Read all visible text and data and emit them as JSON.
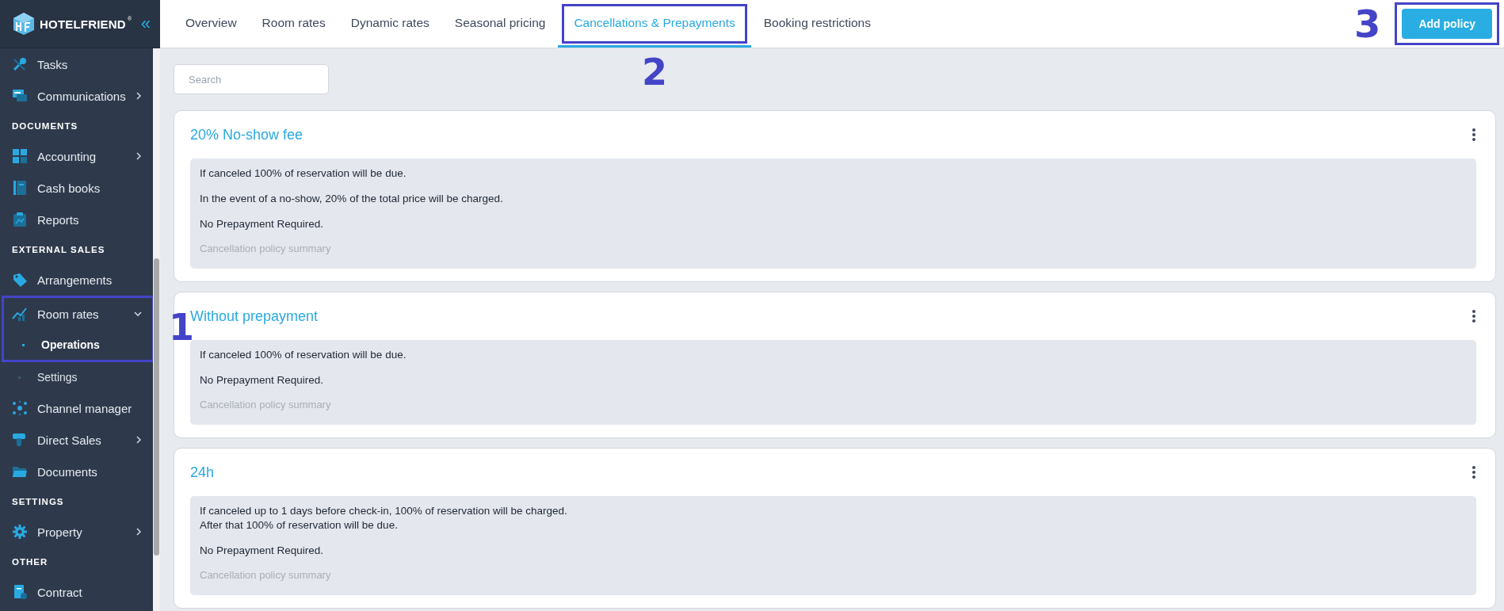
{
  "sidebar": {
    "brand": "HOTELFRIEND",
    "brand_mark": "®",
    "collapse": "«",
    "items": [
      {
        "kind": "item",
        "label": "Tasks",
        "expandable": false
      },
      {
        "kind": "item",
        "label": "Communications",
        "expandable": true,
        "expanded": false
      },
      {
        "kind": "section",
        "label": "DOCUMENTS"
      },
      {
        "kind": "item",
        "label": "Accounting",
        "expandable": true,
        "expanded": false
      },
      {
        "kind": "item",
        "label": "Cash books",
        "expandable": false
      },
      {
        "kind": "item",
        "label": "Reports",
        "expandable": false
      },
      {
        "kind": "section",
        "label": "EXTERNAL SALES"
      },
      {
        "kind": "item",
        "label": "Arrangements",
        "expandable": false
      },
      {
        "kind": "item",
        "label": "Room rates",
        "expandable": true,
        "expanded": true,
        "callout": "1",
        "children": [
          {
            "label": "Operations",
            "selected": true,
            "in_callout": true
          },
          {
            "label": "Settings",
            "selected": false,
            "in_callout": false
          }
        ]
      },
      {
        "kind": "item",
        "label": "Channel manager",
        "expandable": false
      },
      {
        "kind": "item",
        "label": "Direct Sales",
        "expandable": true,
        "expanded": false
      },
      {
        "kind": "item",
        "label": "Documents",
        "expandable": false
      },
      {
        "kind": "section",
        "label": "SETTINGS"
      },
      {
        "kind": "item",
        "label": "Property",
        "expandable": true,
        "expanded": false
      },
      {
        "kind": "section",
        "label": "OTHER"
      },
      {
        "kind": "item",
        "label": "Contract",
        "expandable": false
      }
    ]
  },
  "tabs": [
    {
      "label": "Overview",
      "selected": false
    },
    {
      "label": "Room rates",
      "selected": false
    },
    {
      "label": "Dynamic rates",
      "selected": false
    },
    {
      "label": "Seasonal pricing",
      "selected": false
    },
    {
      "label": "Cancellations & Prepayments",
      "selected": true,
      "callout": "2"
    },
    {
      "label": "Booking restrictions",
      "selected": false
    }
  ],
  "add_button": {
    "label": "Add policy",
    "callout": "3"
  },
  "search": {
    "placeholder": "Search"
  },
  "policies": [
    {
      "title": "20% No-show fee",
      "paragraphs": [
        [
          "If canceled 100% of reservation will be due."
        ],
        [
          "In the event of a no-show, 20% of the total price will be charged."
        ],
        [
          "No Prepayment Required."
        ]
      ],
      "summary_placeholder": "Cancellation policy summary"
    },
    {
      "title": "Without prepayment",
      "paragraphs": [
        [
          "If canceled 100% of reservation will be due."
        ],
        [
          "No Prepayment Required."
        ]
      ],
      "summary_placeholder": "Cancellation policy summary"
    },
    {
      "title": "24h",
      "paragraphs": [
        [
          "If canceled up to 1 days before check-in, 100% of reservation will be charged.",
          "After that 100% of reservation will be due."
        ],
        [
          "No Prepayment Required."
        ]
      ],
      "summary_placeholder": "Cancellation policy summary"
    }
  ]
}
